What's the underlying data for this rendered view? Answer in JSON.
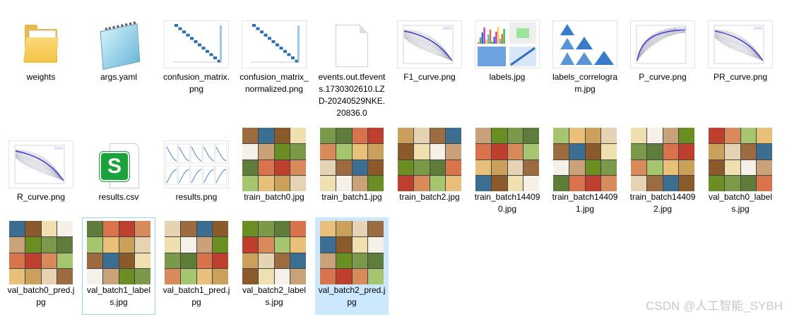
{
  "files": [
    {
      "label": "weights",
      "icon": "folder-icon",
      "kind": "folder"
    },
    {
      "label": "args.yaml",
      "icon": "notepad-icon",
      "kind": "notepad"
    },
    {
      "label": "confusion_matrix.png",
      "icon": "image-thumbnail",
      "kind": "plot",
      "plot": "confusion"
    },
    {
      "label": "confusion_matrix_normalized.png",
      "icon": "image-thumbnail",
      "kind": "plot",
      "plot": "confusion"
    },
    {
      "label": "events.out.tfevents.1730302610.LZD-20240529NKE.20836.0",
      "icon": "document-icon",
      "kind": "doc"
    },
    {
      "label": "F1_curve.png",
      "icon": "image-thumbnail",
      "kind": "plot",
      "plot": "curve-down"
    },
    {
      "label": "labels.jpg",
      "icon": "image-thumbnail",
      "kind": "plot",
      "plot": "labels"
    },
    {
      "label": "labels_correlogram.jpg",
      "icon": "image-thumbnail",
      "kind": "plot",
      "plot": "correlogram"
    },
    {
      "label": "P_curve.png",
      "icon": "image-thumbnail",
      "kind": "plot",
      "plot": "curve-up"
    },
    {
      "label": "PR_curve.png",
      "icon": "image-thumbnail",
      "kind": "plot",
      "plot": "curve-down"
    },
    {
      "label": "R_curve.png",
      "icon": "image-thumbnail",
      "kind": "plot",
      "plot": "curve-down"
    },
    {
      "label": "results.csv",
      "icon": "spreadsheet-icon",
      "kind": "csv",
      "badge": "S"
    },
    {
      "label": "results.png",
      "icon": "image-thumbnail",
      "kind": "plot",
      "plot": "results"
    },
    {
      "label": "train_batch0.jpg",
      "icon": "image-thumbnail",
      "kind": "mosaic"
    },
    {
      "label": "train_batch1.jpg",
      "icon": "image-thumbnail",
      "kind": "mosaic"
    },
    {
      "label": "train_batch2.jpg",
      "icon": "image-thumbnail",
      "kind": "mosaic"
    },
    {
      "label": "train_batch144090.jpg",
      "icon": "image-thumbnail",
      "kind": "mosaic"
    },
    {
      "label": "train_batch144091.jpg",
      "icon": "image-thumbnail",
      "kind": "mosaic"
    },
    {
      "label": "train_batch144092.jpg",
      "icon": "image-thumbnail",
      "kind": "mosaic"
    },
    {
      "label": "val_batch0_labels.jpg",
      "icon": "image-thumbnail",
      "kind": "mosaic"
    },
    {
      "label": "val_batch0_pred.jpg",
      "icon": "image-thumbnail",
      "kind": "mosaic"
    },
    {
      "label": "val_batch1_labels.jpg",
      "icon": "image-thumbnail",
      "kind": "mosaic",
      "state": "focused"
    },
    {
      "label": "val_batch1_pred.jpg",
      "icon": "image-thumbnail",
      "kind": "mosaic"
    },
    {
      "label": "val_batch2_labels.jpg",
      "icon": "image-thumbnail",
      "kind": "mosaic"
    },
    {
      "label": "val_batch2_pred.jpg",
      "icon": "image-thumbnail",
      "kind": "mosaic",
      "state": "selected"
    }
  ],
  "watermark": "CSDN @人工智能_SYBH",
  "colors": {
    "selected_bg": "#cce8ff",
    "focus_border": "#99d1ff",
    "folder": "#f4c247",
    "csv_badge": "#1aa33b"
  }
}
